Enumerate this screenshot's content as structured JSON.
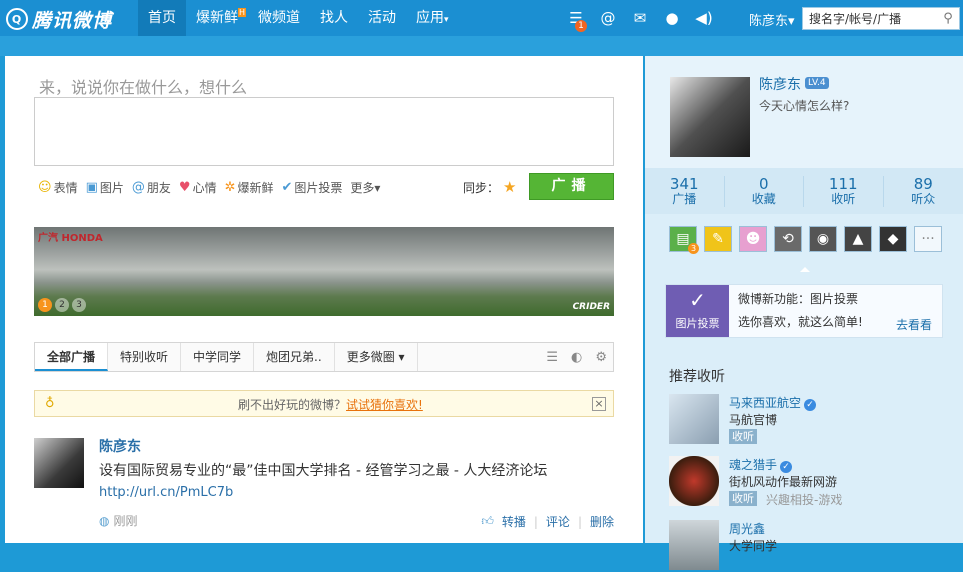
{
  "brand": {
    "logo_text": "腾讯微博",
    "logo_mark": "Q"
  },
  "nav": {
    "items": [
      {
        "label": "首页",
        "active": true
      },
      {
        "label": "爆新鲜",
        "badge": "H"
      },
      {
        "label": "微频道"
      },
      {
        "label": "找人"
      },
      {
        "label": "活动"
      },
      {
        "label": "应用",
        "caret": "▾"
      }
    ]
  },
  "top_icons": {
    "notify_count": "1"
  },
  "user": {
    "name": "陈彦东"
  },
  "search": {
    "placeholder": "搜名字/帐号/广播"
  },
  "composer": {
    "prompt": "来，说说你在做什么，想什么",
    "tools": [
      {
        "icon": "☺",
        "label": "表情"
      },
      {
        "icon": "▣",
        "label": "图片"
      },
      {
        "icon": "@",
        "label": "朋友"
      },
      {
        "icon": "♥",
        "label": "心情"
      },
      {
        "icon": "✲",
        "label": "爆新鲜"
      },
      {
        "icon": "✔",
        "label": "图片投票"
      },
      {
        "icon": "",
        "label": "更多▾"
      }
    ],
    "sync_label": "同步：",
    "post_label": "广播"
  },
  "banner": {
    "brand_text": "广汽 HONDA",
    "dots": [
      "1",
      "2",
      "3"
    ],
    "model_text": "CRIDER"
  },
  "tabs": {
    "items": [
      "全部广播",
      "特别收听",
      "中学同学",
      "炮团兄弟..",
      "更多微圈 ▾"
    ]
  },
  "notice": {
    "text": "刷不出好玩的微博？",
    "link": "试试猜你喜欢!"
  },
  "post": {
    "author": "陈彦东",
    "text": "设有国际贸易专业的“最”佳中国大学排名 - 经管学习之最 - 人大经济论坛",
    "link": "http://url.cn/PmLC7b",
    "time": "刚刚",
    "actions": [
      "转播",
      "评论",
      "删除"
    ]
  },
  "profile": {
    "name": "陈彦东",
    "level": "LV.4",
    "mood": "今天心情怎么样?",
    "stats": [
      {
        "num": "341",
        "label": "广播"
      },
      {
        "num": "0",
        "label": "收藏"
      },
      {
        "num": "111",
        "label": "收听"
      },
      {
        "num": "89",
        "label": "听众"
      }
    ],
    "app_badge": "3",
    "more_apps": "···"
  },
  "feature": {
    "image_label": "图片投票",
    "title": "微博新功能：图片投票",
    "desc": "选你喜欢，就这么简单!",
    "link": "去看看"
  },
  "recommend": {
    "title": "推荐收听",
    "items": [
      {
        "name": "马来西亚航空",
        "desc": "马航官博",
        "button": "收听",
        "tag": ""
      },
      {
        "name": "魂之猎手",
        "desc": "街机风动作最新网游",
        "button": "收听",
        "tag": "兴趣相投-游戏"
      },
      {
        "name": "周光鑫",
        "desc": "大学同学",
        "button": "",
        "tag": ""
      }
    ]
  }
}
